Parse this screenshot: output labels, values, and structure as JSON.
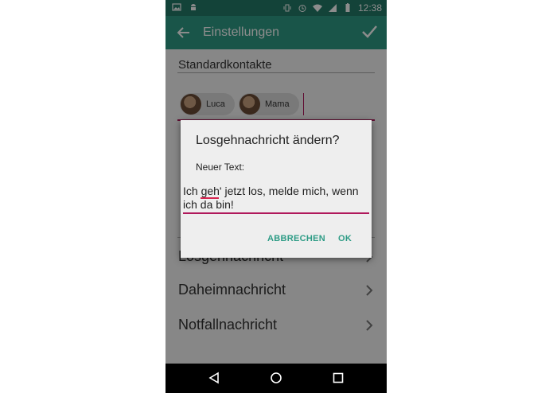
{
  "status_bar": {
    "time": "12:38",
    "left_icons": [
      "image-icon",
      "android-icon"
    ],
    "right_icons": [
      "vibrate-icon",
      "alarm-icon",
      "wifi-icon",
      "signal-icon",
      "battery-icon"
    ]
  },
  "app_bar": {
    "title": "Einstellungen",
    "back_icon": "arrow-left-icon",
    "confirm_icon": "check-icon"
  },
  "contacts": {
    "section_label": "Standardkontakte",
    "chips": [
      {
        "label": "Luca"
      },
      {
        "label": "Mama"
      }
    ]
  },
  "list": {
    "items": [
      {
        "label": "Losgehnachricht"
      },
      {
        "label": "Daheimnachricht"
      },
      {
        "label": "Notfallnachricht"
      }
    ]
  },
  "dialog": {
    "title": "Losgehnachricht ändern?",
    "field_label": "Neuer Text:",
    "input_value": "Ich geh' jetzt los, melde mich, wenn ich da bin!",
    "cancel_label": "ABBRECHEN",
    "ok_label": "OK"
  },
  "colors": {
    "primary": "#2e9c86",
    "primary_dark": "#237a69",
    "accent": "#b0185b"
  }
}
